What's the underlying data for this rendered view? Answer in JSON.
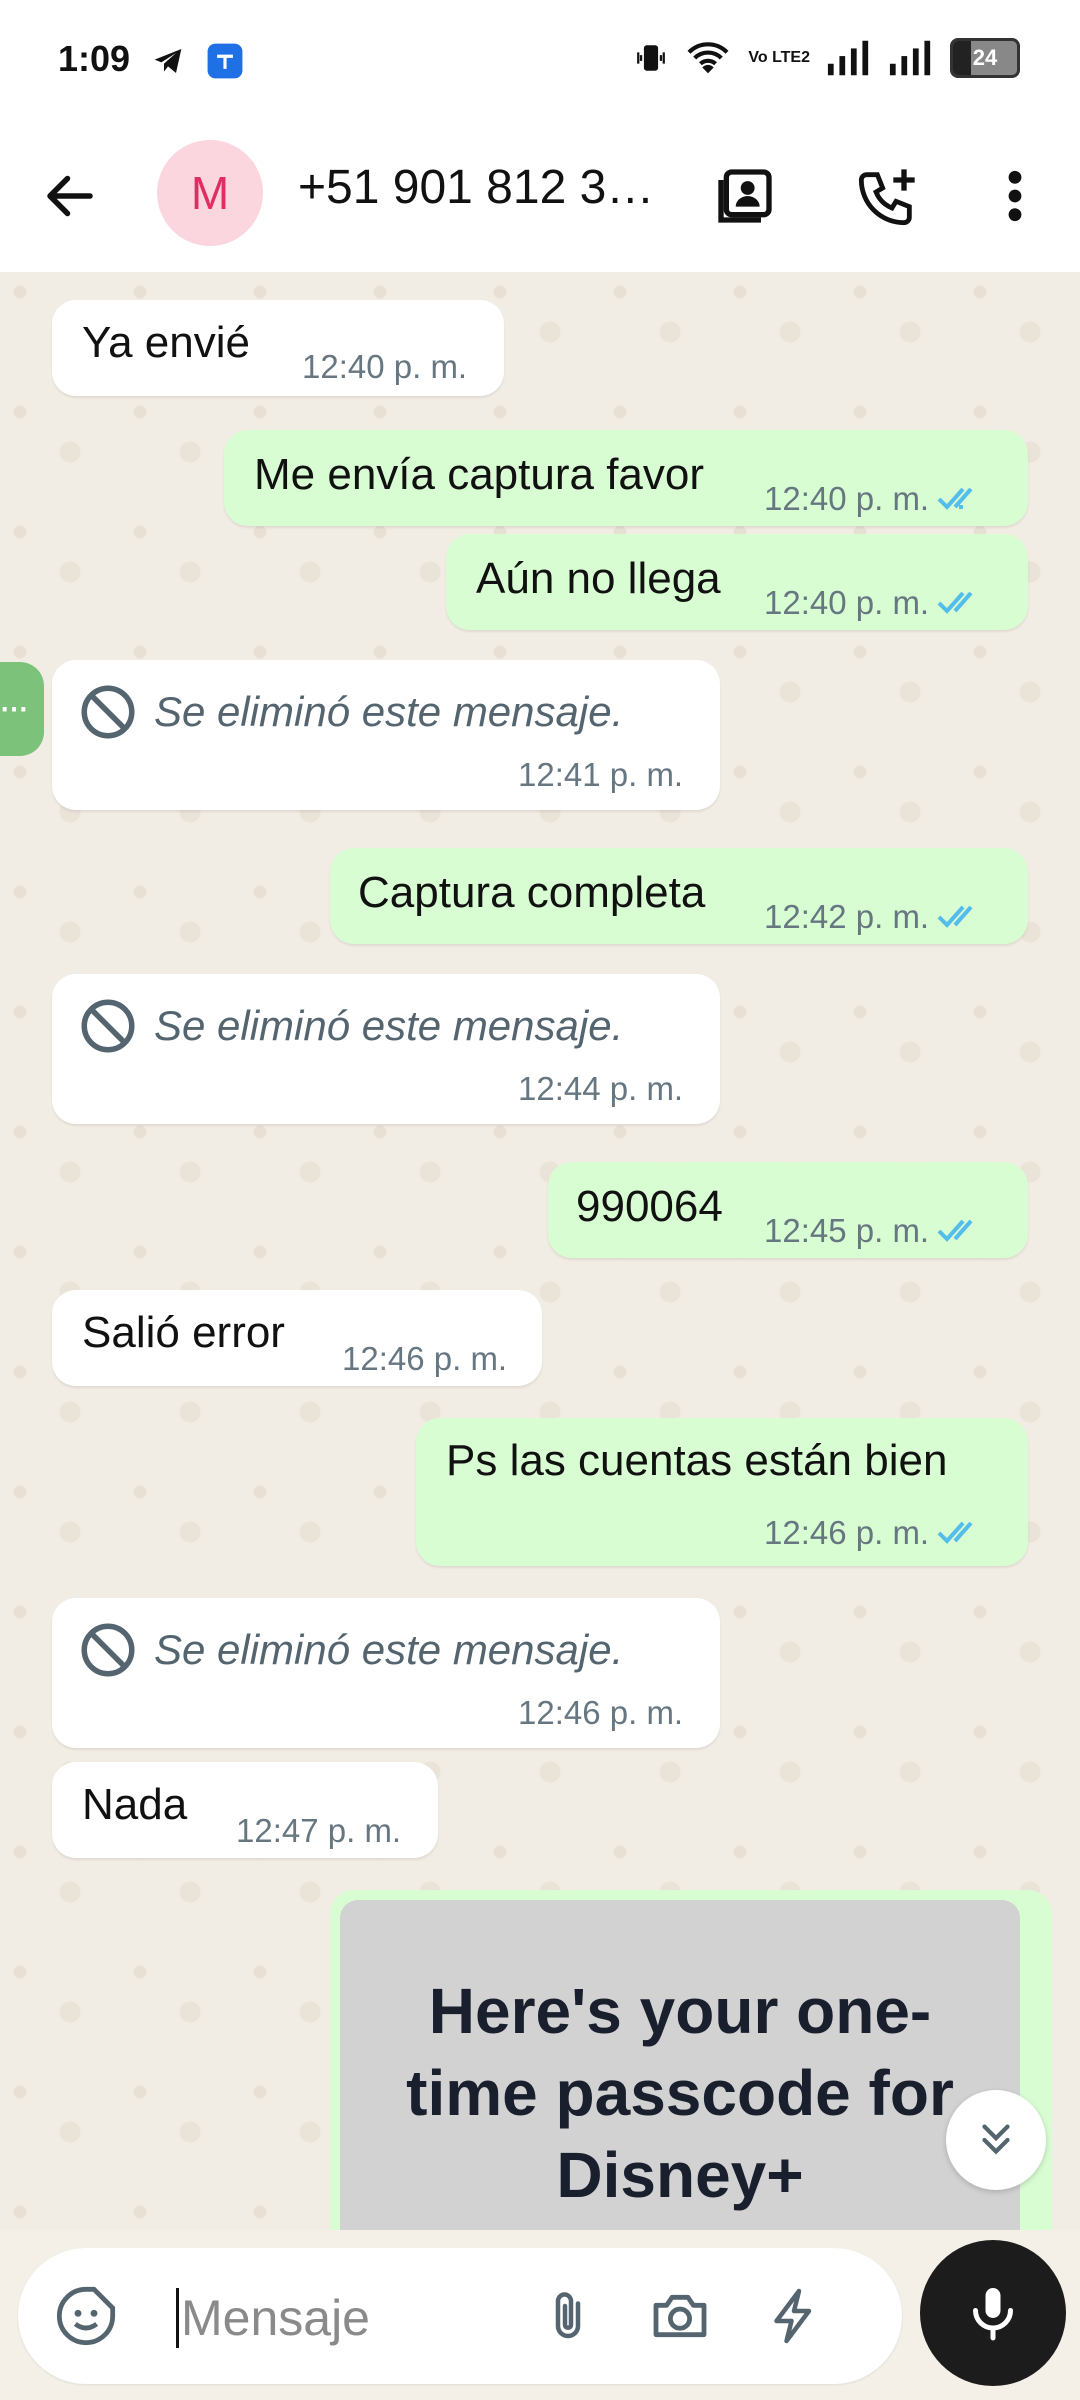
{
  "status_bar": {
    "time": "1:09",
    "battery": "24",
    "volte": "Vo LTE2"
  },
  "header": {
    "avatar_letter": "M",
    "contact_name": "+51 901 812 3…"
  },
  "messages": [
    {
      "dir": "in",
      "text": "Ya envié",
      "time": "12:40 p. m."
    },
    {
      "dir": "out",
      "text": "Me envía captura favor",
      "time": "12:40 p. m."
    },
    {
      "dir": "out",
      "text": "Aún no llega",
      "time": "12:40 p. m."
    },
    {
      "dir": "in",
      "deleted": true,
      "text": "Se eliminó este mensaje.",
      "time": "12:41 p. m."
    },
    {
      "dir": "out",
      "text": "Captura completa",
      "time": "12:42 p. m."
    },
    {
      "dir": "in",
      "deleted": true,
      "text": "Se eliminó este mensaje.",
      "time": "12:44 p. m."
    },
    {
      "dir": "out",
      "text": "990064",
      "time": "12:45 p. m."
    },
    {
      "dir": "in",
      "text": "Salió error",
      "time": "12:46 p. m."
    },
    {
      "dir": "out",
      "text": "Ps las cuentas están bien",
      "time": "12:46 p. m."
    },
    {
      "dir": "in",
      "deleted": true,
      "text": "Se eliminó este mensaje.",
      "time": "12:46 p. m."
    },
    {
      "dir": "in",
      "text": "Nada",
      "time": "12:47 p. m."
    }
  ],
  "image_message": {
    "text_line1": "Here's your one-",
    "text_line2": "time passcode for",
    "text_line3": "Disney+"
  },
  "composer": {
    "placeholder": "Mensaje"
  },
  "colors": {
    "incoming": "#ffffff",
    "outgoing": "#d9fdd3",
    "read_ticks": "#53bdeb",
    "avatar_bg": "#fbd6df",
    "avatar_fg": "#e22d63"
  }
}
